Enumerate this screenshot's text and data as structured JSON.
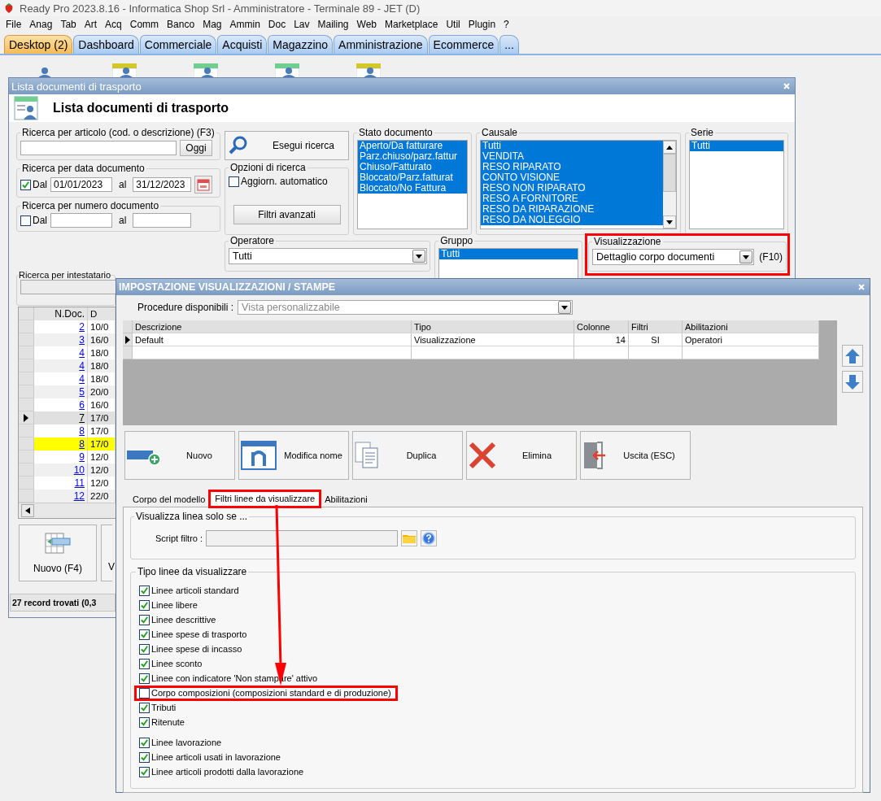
{
  "app": {
    "title": "Ready Pro 2023.8.16 - Informatica Shop Srl - Amministratore - Terminale 89 - JET (D)"
  },
  "menu": [
    "File",
    "Anag",
    "Tab",
    "Art",
    "Acq",
    "Comm",
    "Banco",
    "Mag",
    "Ammin",
    "Doc",
    "Lav",
    "Mailing",
    "Web",
    "Marketplace",
    "Util",
    "Plugin",
    "?"
  ],
  "tabs": [
    {
      "label": "Desktop (2)",
      "selected": true
    },
    {
      "label": "Dashboard",
      "selected": false
    },
    {
      "label": "Commerciale",
      "selected": false
    },
    {
      "label": "Acquisti",
      "selected": false
    },
    {
      "label": "Magazzino",
      "selected": false
    },
    {
      "label": "Amministrazione",
      "selected": false
    },
    {
      "label": "Ecommerce",
      "selected": false
    },
    {
      "label": "...",
      "selected": false
    }
  ],
  "list_window": {
    "title": "Lista documenti di trasporto",
    "heading": "Lista documenti di trasporto",
    "article_search": {
      "label": "Ricerca per articolo (cod. o descrizione) (F3)",
      "button": "Oggi"
    },
    "date_search": {
      "label": "Ricerca per data documento",
      "checkbox": {
        "label": "Dal",
        "checked": true
      },
      "from": "01/01/2023",
      "to_label": "al",
      "to": "31/12/2023"
    },
    "number_search": {
      "label": "Ricerca per numero documento",
      "checkbox": {
        "label": "Dal",
        "checked": false
      },
      "to_label": "al"
    },
    "search_button": "Esegui ricerca",
    "search_options": {
      "label": "Opzioni di ricerca",
      "auto_update": {
        "label": "Aggiorn. automatico",
        "checked": false
      },
      "button": "Filtri avanzati"
    },
    "status_list": {
      "label": "Stato documento",
      "items": [
        {
          "text": "Aperto/Da fatturare",
          "selected": true
        },
        {
          "text": "Parz.chiuso/parz.fattur",
          "selected": true
        },
        {
          "text": "Chiuso/Fatturato",
          "selected": true
        },
        {
          "text": "Bloccato/Parz.fatturat",
          "selected": true
        },
        {
          "text": "Bloccato/No Fattura",
          "selected": true
        }
      ]
    },
    "reason_list": {
      "label": "Causale",
      "items": [
        {
          "text": "Tutti",
          "selected": true
        },
        {
          "text": "VENDITA",
          "selected": true
        },
        {
          "text": "RESO RIPARATO",
          "selected": true
        },
        {
          "text": "CONTO VISIONE",
          "selected": true
        },
        {
          "text": "RESO NON RIPARATO",
          "selected": true
        },
        {
          "text": "RESO A FORNITORE",
          "selected": true
        },
        {
          "text": "RESO DA RIPARAZIONE",
          "selected": true
        },
        {
          "text": "RESO DA NOLEGGIO",
          "selected": true
        }
      ]
    },
    "series_list": {
      "label": "Serie",
      "items": [
        {
          "text": "Tutti",
          "selected": true
        }
      ]
    },
    "operator": {
      "label": "Operatore",
      "value": "Tutti"
    },
    "group_list": {
      "label": "Gruppo",
      "items": [
        {
          "text": "Tutti",
          "selected": true
        }
      ]
    },
    "view": {
      "label": "Visualizzazione",
      "value": "Dettaglio corpo documenti",
      "shortcut": "(F10)",
      "highlighted": true
    },
    "holder_search": {
      "label": "Ricerca per intestatario"
    },
    "table": {
      "columns": [
        "N.Doc.",
        "D"
      ],
      "rows": [
        {
          "number": "2",
          "date": "10/0",
          "current": false,
          "highlighted": false
        },
        {
          "number": "3",
          "date": "16/0",
          "current": false,
          "highlighted": false
        },
        {
          "number": "4",
          "date": "18/0",
          "current": false,
          "highlighted": false
        },
        {
          "number": "4",
          "date": "18/0",
          "current": false,
          "highlighted": false
        },
        {
          "number": "4",
          "date": "18/0",
          "current": false,
          "highlighted": false
        },
        {
          "number": "5",
          "date": "20/0",
          "current": false,
          "highlighted": false
        },
        {
          "number": "6",
          "date": "16/0",
          "current": false,
          "highlighted": false
        },
        {
          "number": "7",
          "date": "17/0",
          "current": true,
          "highlighted": false
        },
        {
          "number": "8",
          "date": "17/0",
          "current": false,
          "highlighted": false
        },
        {
          "number": "8",
          "date": "17/0",
          "current": false,
          "highlighted": true
        },
        {
          "number": "9",
          "date": "12/0",
          "current": false,
          "highlighted": false
        },
        {
          "number": "10",
          "date": "12/0",
          "current": false,
          "highlighted": false
        },
        {
          "number": "11",
          "date": "12/0",
          "current": false,
          "highlighted": false
        },
        {
          "number": "12",
          "date": "22/0",
          "current": false,
          "highlighted": false
        }
      ]
    },
    "buttons": [
      "Nuovo (F4)",
      "V"
    ],
    "status_bar": "27 record trovati (0,3"
  },
  "settings_dialog": {
    "title": "IMPOSTAZIONE VISUALIZZAZIONI / STAMPE",
    "procedure": {
      "label": "Procedure disponibili :",
      "value": "Vista personalizzabile",
      "disabled": true
    },
    "grid": {
      "columns": [
        "Descrizione",
        "Tipo",
        "Colonne",
        "Filtri",
        "Abilitazioni"
      ],
      "rows": [
        {
          "cells": [
            "Default",
            "Visualizzazione",
            "14",
            "SI",
            "Operatori"
          ],
          "current": true
        }
      ]
    },
    "buttons": [
      {
        "label": "Nuovo",
        "kind": "new"
      },
      {
        "label": "Modifica nome",
        "kind": "rename"
      },
      {
        "label": "Duplica",
        "kind": "duplicate"
      },
      {
        "label": "Elimina",
        "kind": "delete"
      },
      {
        "label": "Uscita (ESC)",
        "kind": "exit"
      }
    ],
    "tabs": [
      {
        "label": "Corpo del modello",
        "selected": false,
        "highlighted": false
      },
      {
        "label": "Filtri linee da visualizzare",
        "selected": true,
        "highlighted": true
      },
      {
        "label": "Abilitazioni",
        "selected": false,
        "highlighted": false
      }
    ],
    "filter_group": {
      "label": "Visualizza linea solo se ...",
      "script_label": "Script filtro :"
    },
    "line_types": {
      "label": "Tipo linee da visualizzare",
      "groups": [
        {
          "items": [
            {
              "label": "Linee articoli standard",
              "checked": true,
              "highlighted": false
            },
            {
              "label": "Linee libere",
              "checked": true,
              "highlighted": false
            },
            {
              "label": "Linee descrittive",
              "checked": true,
              "highlighted": false
            },
            {
              "label": "Linee spese di trasporto",
              "checked": true,
              "highlighted": false
            },
            {
              "label": "Linee spese di incasso",
              "checked": true,
              "highlighted": false
            },
            {
              "label": "Linee sconto",
              "checked": true,
              "highlighted": false
            },
            {
              "label": "Linee con indicatore 'Non stampare' attivo",
              "checked": true,
              "highlighted": false
            },
            {
              "label": "Corpo composizioni (composizioni standard e di produzione)",
              "checked": false,
              "highlighted": true
            },
            {
              "label": "Tributi",
              "checked": true,
              "highlighted": false
            },
            {
              "label": "Ritenute",
              "checked": true,
              "highlighted": false
            }
          ]
        },
        {
          "items": [
            {
              "label": "Linee lavorazione",
              "checked": true,
              "highlighted": false
            },
            {
              "label": "Linee articoli usati in lavorazione",
              "checked": true,
              "highlighted": false
            },
            {
              "label": "Linee articoli prodotti dalla lavorazione",
              "checked": true,
              "highlighted": false
            }
          ]
        }
      ]
    }
  }
}
